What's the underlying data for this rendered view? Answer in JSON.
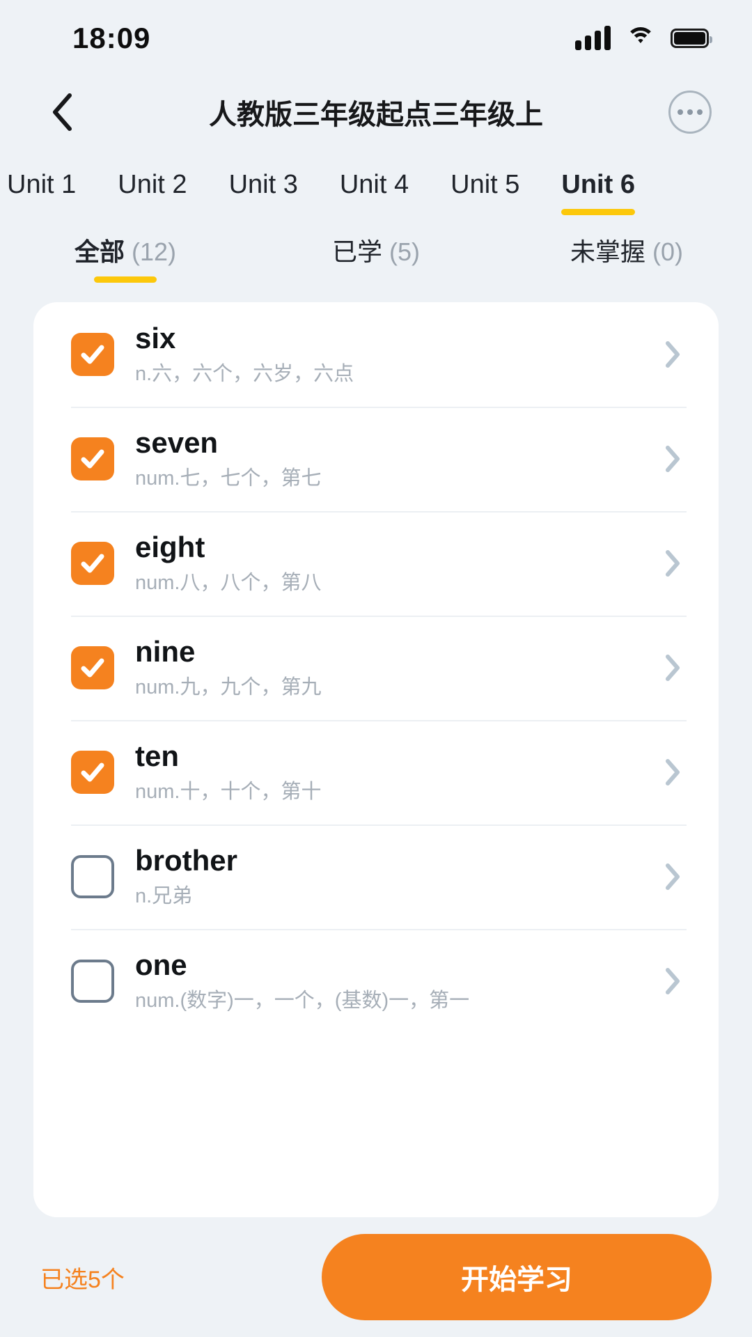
{
  "status_bar": {
    "time": "18:09",
    "signal_icon": "cellular-signal-icon",
    "wifi_icon": "wifi-icon",
    "battery_icon": "battery-full-icon"
  },
  "header": {
    "back_icon": "chevron-left-icon",
    "title": "人教版三年级起点三年级上",
    "more_icon": "more-horizontal-icon"
  },
  "unit_tabs": {
    "active_index": 5,
    "items": [
      {
        "label": "Unit 1"
      },
      {
        "label": "Unit 2"
      },
      {
        "label": "Unit 3"
      },
      {
        "label": "Unit 4"
      },
      {
        "label": "Unit 5"
      },
      {
        "label": "Unit 6"
      }
    ]
  },
  "filter_tabs": {
    "active_index": 0,
    "items": [
      {
        "name": "全部",
        "count": "(12)"
      },
      {
        "name": "已学",
        "count": "(5)"
      },
      {
        "name": "未掌握",
        "count": "(0)"
      }
    ]
  },
  "word_list": {
    "chevron_icon": "chevron-right-icon",
    "check_icon": "check-icon",
    "items": [
      {
        "word": "six",
        "definition": "n.六，六个，六岁，六点",
        "checked": true
      },
      {
        "word": "seven",
        "definition": "num.七，七个，第七",
        "checked": true
      },
      {
        "word": "eight",
        "definition": "num.八，八个，第八",
        "checked": true
      },
      {
        "word": "nine",
        "definition": "num.九，九个，第九",
        "checked": true
      },
      {
        "word": "ten",
        "definition": "num.十，十个，第十",
        "checked": true
      },
      {
        "word": "brother",
        "definition": "n.兄弟",
        "checked": false
      },
      {
        "word": "one",
        "definition": "num.(数字)一，一个，(基数)一，第一",
        "checked": false
      }
    ]
  },
  "bottom_bar": {
    "selected_label": "已选5个",
    "start_button_label": "开始学习"
  },
  "colors": {
    "accent_orange": "#f5821f",
    "accent_yellow": "#fcc80b",
    "page_background": "#eef2f6",
    "card_background": "#ffffff",
    "definition_text": "#a6aeb7",
    "chevron": "#b9c6d1"
  }
}
